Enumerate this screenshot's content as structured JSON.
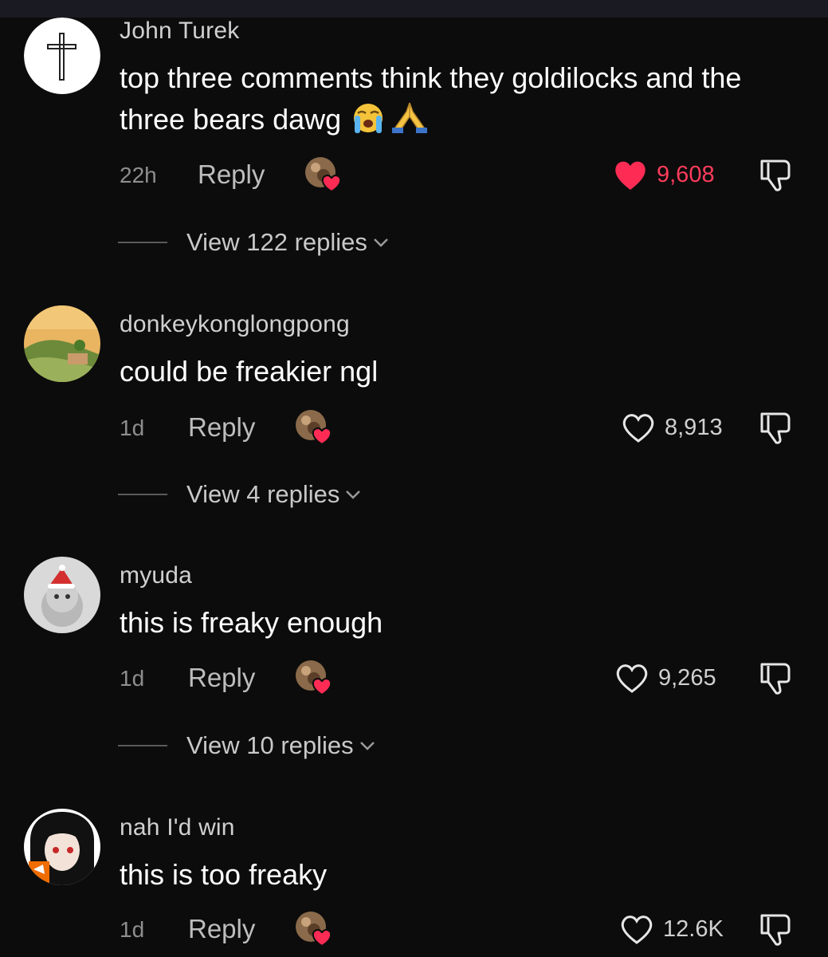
{
  "comments": [
    {
      "username": "John Turek",
      "text": "top three comments think they goldilocks and the three bears dawg",
      "emojis": [
        "loudly-crying-face-icon",
        "folded-hands-icon"
      ],
      "time": "22h",
      "reply_label": "Reply",
      "likes": "9,608",
      "liked": true,
      "view_replies": "View 122 replies",
      "avatar_icon": "cross-icon"
    },
    {
      "username": "donkeykonglongpong",
      "text": "could be freakier ngl",
      "time": "1d",
      "reply_label": "Reply",
      "likes": "8,913",
      "liked": false,
      "view_replies": "View 4 replies"
    },
    {
      "username": "myuda",
      "text": "this is freaky enough",
      "time": "1d",
      "reply_label": "Reply",
      "likes": "9,265",
      "liked": false,
      "view_replies": "View 10 replies"
    },
    {
      "username": "nah I'd win",
      "text": "this is too freaky",
      "time": "1d",
      "reply_label": "Reply",
      "likes": "12.6K",
      "liked": false
    }
  ],
  "colors": {
    "background": "#0c0c0c",
    "liked_heart": "#fe3c5c",
    "text_primary": "#ffffff",
    "text_secondary": "#8e8e8e"
  }
}
